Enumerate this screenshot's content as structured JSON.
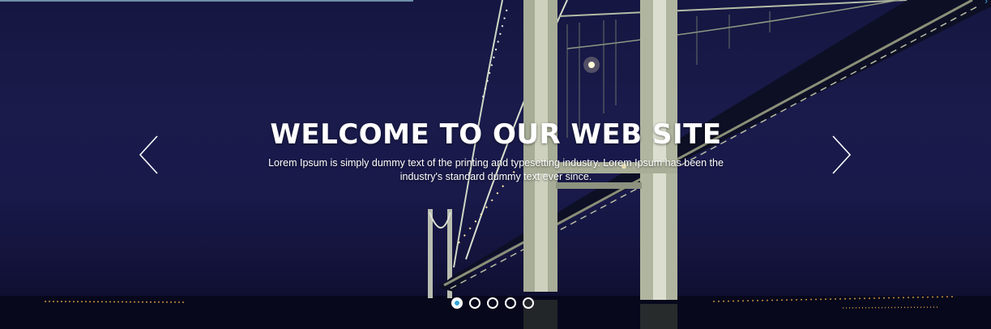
{
  "slider": {
    "title": "WELCOME TO OUR WEB SITE",
    "description": "Lorem Ipsum is simply dummy text of the printing and typesetting industry. Lorem Ipsum has been the industry's standard dummy text ever since.",
    "prev_icon": "chevron-left-icon",
    "next_icon": "chevron-right-icon",
    "slide_count": 5,
    "active_slide": 1,
    "background_image": "night-suspension-bridge"
  },
  "colors": {
    "accent": "#2fa4d8",
    "text": "#ffffff",
    "sky": "#1b1c4c"
  }
}
